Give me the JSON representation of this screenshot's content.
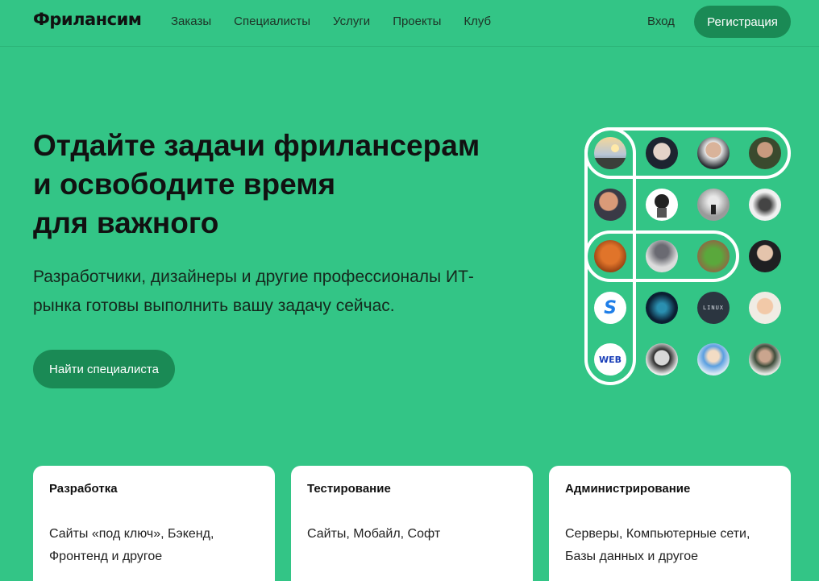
{
  "header": {
    "logo": "Фрилансим",
    "nav": [
      "Заказы",
      "Специалисты",
      "Услуги",
      "Проекты",
      "Клуб"
    ],
    "login": "Вход",
    "register": "Регистрация"
  },
  "hero": {
    "title_lines": [
      "Отдайте задачи фрилансерам",
      "и освободите время",
      "для важного"
    ],
    "subtitle_lines": [
      "Разработчики, дизайнеры и другие профессионалы ИТ-",
      "рынка готовы выполнить вашу задачу сейчас."
    ],
    "cta": "Найти специалиста"
  },
  "avatars": {
    "logos": [
      "S",
      "WEB"
    ],
    "linux_text": "LINUX"
  },
  "cards": [
    {
      "title": "Разработка",
      "text_lines": [
        "Сайты «под ключ», Бэкенд,",
        "Фронтенд и другое"
      ]
    },
    {
      "title": "Тестирование",
      "text_lines": [
        "Сайты, Мобайл, Софт"
      ]
    },
    {
      "title": "Администрирование",
      "text_lines": [
        "Серверы, Компьютерные сети,",
        "Базы данных и другое"
      ]
    }
  ],
  "colors": {
    "background": "#33c586",
    "accent": "#1a8a55"
  }
}
